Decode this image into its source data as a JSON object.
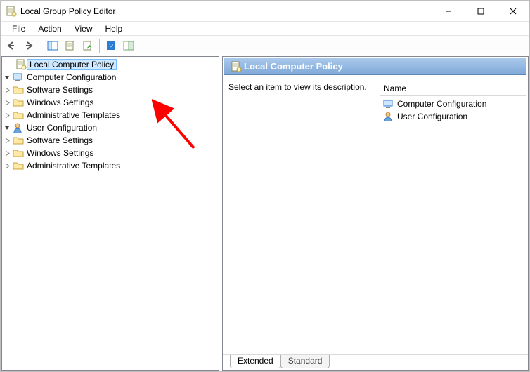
{
  "window": {
    "title": "Local Group Policy Editor"
  },
  "menus": {
    "file": "File",
    "action": "Action",
    "view": "View",
    "help": "Help"
  },
  "tree": {
    "root": "Local Computer Policy",
    "computer_config": "Computer Configuration",
    "software_settings": "Software Settings",
    "windows_settings": "Windows Settings",
    "admin_templates": "Administrative Templates",
    "user_config": "User Configuration"
  },
  "right": {
    "header": "Local Computer Policy",
    "description": "Select an item to view its description.",
    "column_name": "Name",
    "items": {
      "computer": "Computer Configuration",
      "user": "User Configuration"
    }
  },
  "tabs": {
    "extended": "Extended",
    "standard": "Standard"
  }
}
